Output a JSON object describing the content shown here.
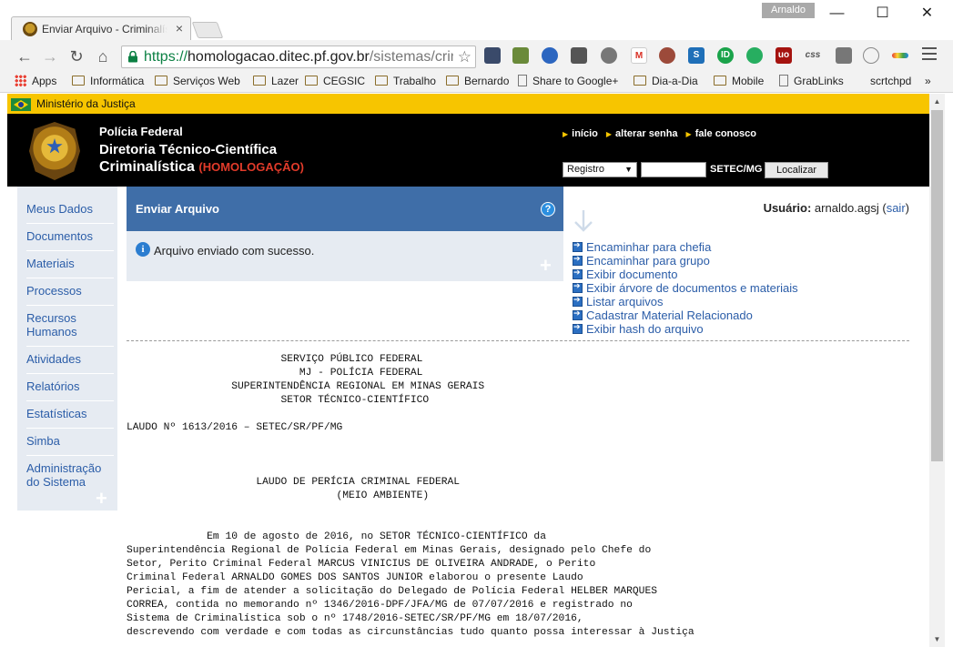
{
  "browser": {
    "tab_title": "Enviar Arquivo - Criminalística",
    "tab_close": "×",
    "user_chip": "Arnaldo",
    "window_controls": {
      "minimize": "—",
      "maximize": "☐",
      "close": "✕"
    },
    "nav": {
      "back": "←",
      "forward": "→",
      "reload": "↻",
      "home": "⌂"
    },
    "url": {
      "scheme": "https://",
      "host": "homologacao.ditec.pf.gov.br",
      "path": "/sistemas/criminalistica"
    },
    "extension_icons": [
      "library-icon",
      "puzzle-icon",
      "pin-icon",
      "save-icon",
      "ghost-icon",
      "gmail-icon",
      "ball-icon",
      "s-icon",
      "id-icon",
      "chat-icon",
      "ublock-icon",
      "css-icon",
      "eye-icon",
      "search-icon",
      "rainbow-icon"
    ],
    "extension_labels": {
      "css": "css",
      "ublock": "uo",
      "id": "ID",
      "s": "S"
    },
    "bookmarks": [
      {
        "label": "Apps",
        "type": "apps"
      },
      {
        "label": "Informática",
        "type": "folder"
      },
      {
        "label": "Serviços Web",
        "type": "folder"
      },
      {
        "label": "Lazer",
        "type": "folder"
      },
      {
        "label": "CEGSIC",
        "type": "folder"
      },
      {
        "label": "Trabalho",
        "type": "folder"
      },
      {
        "label": "Bernardo",
        "type": "folder"
      },
      {
        "label": "Share to Google+",
        "type": "page"
      },
      {
        "label": "Dia-a-Dia",
        "type": "folder"
      },
      {
        "label": "Mobile",
        "type": "folder"
      },
      {
        "label": "GrabLinks",
        "type": "page"
      },
      {
        "label": "scrtchpd",
        "type": "plain"
      }
    ],
    "bookmarks_more": "»"
  },
  "site": {
    "ministry": "Ministério da Justiça",
    "header": {
      "line1": "Polícia Federal",
      "line2": "Diretoria Técnico-Científica",
      "line3": "Criminalística",
      "env": "(HOMOLOGAÇÃO)"
    },
    "toplinks": [
      "início",
      "alterar senha",
      "fale conosco"
    ],
    "search": {
      "select_value": "Registro",
      "unit": "SETEC/MG",
      "button": "Localizar"
    },
    "sidebar": [
      {
        "label": "Meus Dados"
      },
      {
        "label": "Documentos"
      },
      {
        "label": "Materiais"
      },
      {
        "label": "Processos"
      },
      {
        "label": "Recursos Humanos"
      },
      {
        "label": "Atividades"
      },
      {
        "label": "Relatórios"
      },
      {
        "label": "Estatísticas"
      },
      {
        "label": "Simba"
      },
      {
        "label": "Administração do Sistema"
      }
    ],
    "panel": {
      "title": "Enviar Arquivo",
      "help": "?",
      "message": "Arquivo enviado com sucesso."
    },
    "user": {
      "label": "Usuário:",
      "name": "arnaldo.agsj",
      "logout": "sair"
    },
    "actions": [
      "Encaminhar para chefia",
      "Encaminhar para grupo",
      "Exibir documento",
      "Exibir árvore de documentos e materiais",
      "Listar arquivos",
      "Cadastrar Material Relacionado",
      "Exibir hash do arquivo"
    ],
    "document": {
      "header_lines": [
        "                         SERVIÇO PÚBLICO FEDERAL",
        "                            MJ - POLÍCIA FEDERAL",
        "                 SUPERINTENDÊNCIA REGIONAL EM MINAS GERAIS",
        "                         SETOR TÉCNICO-CIENTÍFICO"
      ],
      "laudo_number": "LAUDO Nº 1613/2016 – SETEC/SR/PF/MG",
      "title_lines": [
        "                     LAUDO DE PERÍCIA CRIMINAL FEDERAL",
        "                                  (MEIO AMBIENTE)"
      ],
      "body_lines": [
        "             Em 10 de agosto de 2016, no SETOR TÉCNICO-CIENTÍFICO da",
        "Superintendência Regional de Polícia Federal em Minas Gerais, designado pelo Chefe do",
        "Setor, Perito Criminal Federal MARCUS VINICIUS DE OLIVEIRA ANDRADE, o Perito",
        "Criminal Federal ARNALDO GOMES DOS SANTOS JUNIOR elaborou o presente Laudo",
        "Pericial, a fim de atender a solicitação do Delegado de Polícia Federal HELBER MARQUES",
        "CORREA, contida no memorando nº 1346/2016-DPF/JFA/MG de 07/07/2016 e registrado no",
        "Sistema de Criminalística sob o nº 1748/2016-SETEC/SR/PF/MG em 18/07/2016,",
        "descrevendo com verdade e com todas as circunstâncias tudo quanto possa interessar à Justiça"
      ]
    }
  }
}
